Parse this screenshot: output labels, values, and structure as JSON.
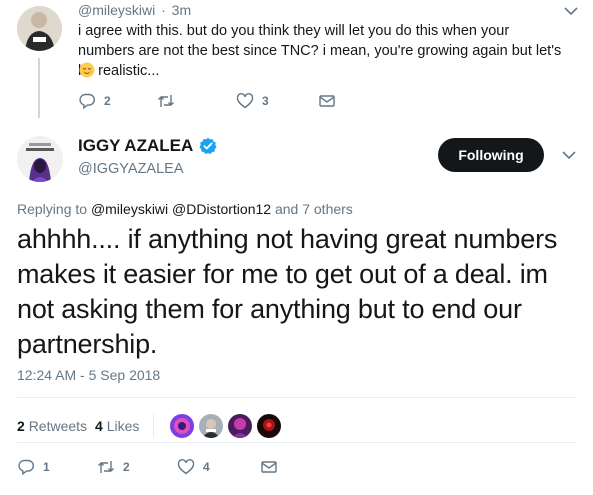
{
  "reply_tweet": {
    "handle": "@mileyskiwi",
    "separator": "·",
    "time": "3m",
    "text": "i agree with this. but do you think they will let you do this when your numbers are not the best since TNC? i mean, you're growing again but let's be realistic...",
    "emoji_icon": "relieved-face-emoji",
    "actions": {
      "reply_count": "2",
      "retweet_count": "",
      "like_count": "3"
    }
  },
  "main_tweet": {
    "author_name": "IGGY AZALEA",
    "author_handle": "@IGGYAZALEA",
    "verified": true,
    "follow_button": "Following",
    "replying_prefix": "Replying to",
    "replying_to": "@mileyskiwi @DDistortion12",
    "replying_suffix": "and 7 others",
    "text": "ahhhh.... if anything not having great numbers makes it easier for me to get out of a deal. im not asking them for anything but to end our partnership.",
    "timestamp": "12:24 AM - 5 Sep 2018",
    "stats": {
      "retweets_count": "2",
      "retweets_label": "Retweets",
      "likes_count": "4",
      "likes_label": "Likes"
    },
    "actions": {
      "reply_count": "1",
      "retweet_count": "2",
      "like_count": "4"
    }
  },
  "colors": {
    "accent_blue": "#1da1f2",
    "muted_text": "#657786",
    "button_dark": "#14171a",
    "divider": "#e6ecf0"
  }
}
